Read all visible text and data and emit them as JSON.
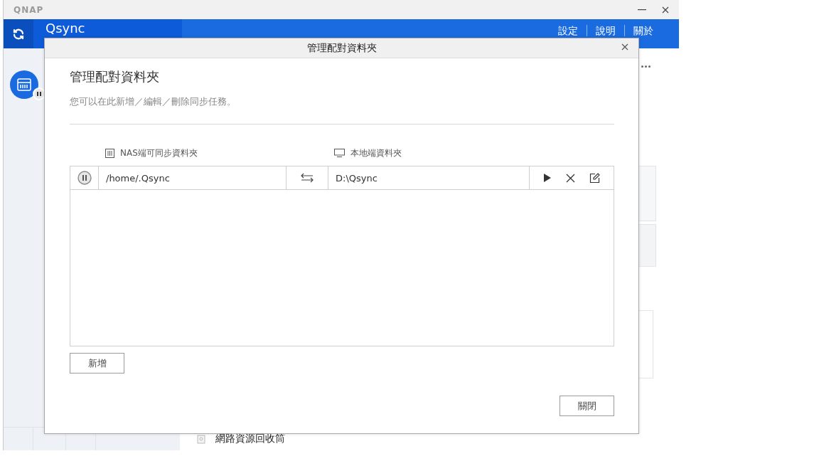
{
  "app": {
    "logo": "QNAP",
    "name": "Qsync",
    "nav": [
      "設定",
      "說明",
      "關於"
    ],
    "recycle_bin": "網路資源回收筒"
  },
  "dialog": {
    "title": "管理配對資料夾",
    "heading": "管理配對資料夾",
    "description": "您可以在此新增／編輯／刪除同步任務。",
    "columns": [
      {
        "kind": "nas",
        "label": "NAS端可同步資料夾"
      },
      {
        "kind": "local",
        "label": "本地端資料夾"
      }
    ],
    "pairs": [
      {
        "nas_folder": "/home/.Qsync",
        "local_folder": "D:\\Qsync",
        "paused": true
      }
    ],
    "add_button": "新增",
    "close_button": "關閉"
  }
}
